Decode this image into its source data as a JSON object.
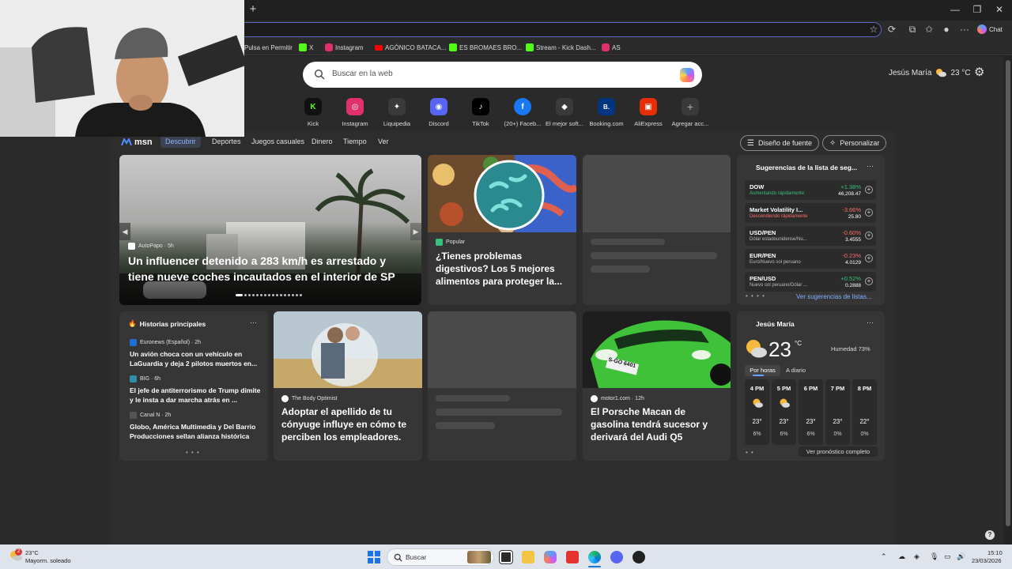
{
  "browser": {
    "new_tab": "+",
    "minimize": "—",
    "maximize": "❐",
    "close": "✕",
    "chat_label": "Chat"
  },
  "favorites": [
    {
      "label": "Pulsa en Permitir",
      "color": ""
    },
    {
      "label": "X",
      "color": "#53fc18"
    },
    {
      "label": "Instagram",
      "color": "#e1306c"
    },
    {
      "label": "AGÓNICO BATACA...",
      "color": "#ff0000"
    },
    {
      "label": "ES BROMAES BRO...",
      "color": "#53fc18"
    },
    {
      "label": "Stream - Kick Dash...",
      "color": "#53fc18"
    },
    {
      "label": "AS",
      "color": "#e1306c"
    }
  ],
  "search": {
    "placeholder": "Buscar en la web"
  },
  "header": {
    "location": "Jesús María",
    "temp": "23 °C"
  },
  "quicklinks": [
    {
      "label": "Kick",
      "glyph": "K",
      "color": "#53fc18"
    },
    {
      "label": "Instagram",
      "glyph": "◎",
      "color": "#e1306c"
    },
    {
      "label": "Liquipedia",
      "glyph": "✦",
      "color": "#3a3a3a"
    },
    {
      "label": "Discord",
      "glyph": "◉",
      "color": "#5865f2"
    },
    {
      "label": "TikTok",
      "glyph": "♪",
      "color": "#000000"
    },
    {
      "label": "(20+) Faceb...",
      "glyph": "f",
      "color": "#1877f2"
    },
    {
      "label": "El mejor soft...",
      "glyph": "◆",
      "color": "#3a3a3a"
    },
    {
      "label": "Booking.com",
      "glyph": "B.",
      "color": "#003580"
    },
    {
      "label": "AliExpress",
      "glyph": "▣",
      "color": "#e62e04"
    },
    {
      "label": "Agregar acc...",
      "glyph": "+",
      "color": "#3a3a3a"
    }
  ],
  "feed_nav": {
    "logo": "msn",
    "items": [
      "Descubrir",
      "Deportes",
      "Juegos casuales",
      "Dinero",
      "Tiempo",
      "Ver"
    ],
    "font_design": "Diseño de fuente",
    "personalize": "Personalizar"
  },
  "hero": {
    "source": "AutoPapo · 5h",
    "headline": "Un influencer detenido a 283 km/h es arrestado y tiene nueve coches incautados en el interior de SP"
  },
  "card_digestive": {
    "source": "Popular",
    "headline": "¿Tienes problemas digestivos? Los 5 mejores alimentos para proteger la..."
  },
  "watchlist": {
    "title": "Sugerencias de la lista de seg...",
    "more": "···",
    "link": "Ver sugerencias de listas...",
    "items": [
      {
        "name": "DOW",
        "sub": "Aumentando rápidamente",
        "pct": "+1.38%",
        "value": "46,208.47",
        "up": true
      },
      {
        "name": "Market Volatility I...",
        "sub": "Descendiendo rápidamente",
        "pct": "-3.66%",
        "value": "25.80",
        "up": false
      },
      {
        "name": "USD/PEN",
        "sub": "Dólar estadounidense/Nu...",
        "pct": "-0.60%",
        "value": "3.4555",
        "up": false
      },
      {
        "name": "EUR/PEN",
        "sub": "Euro/Nuevo sol peruano",
        "pct": "-0.23%",
        "value": "4.0129",
        "up": false
      },
      {
        "name": "PEN/USD",
        "sub": "Nuevo sol peruano/Dólar ...",
        "pct": "+0.52%",
        "value": "0.2888",
        "up": true
      }
    ]
  },
  "top_stories": {
    "title": "Historias principales",
    "more": "···",
    "items": [
      {
        "source": "Euronews (Español) · 2h",
        "headline": "Un avión choca con un vehículo en LaGuardia y deja 2 pilotos muertos en..."
      },
      {
        "source": "BIG · 6h",
        "headline": "El jefe de antiterrorismo de Trump dimite y le insta a dar marcha atrás en ..."
      },
      {
        "source": "Canal N · 2h",
        "headline": "Globo, América Multimedia y Del Barrio Producciones sellan alianza histórica"
      }
    ]
  },
  "card_wedding": {
    "source": "The Body Optimist",
    "headline": "Adoptar el apellido de tu cónyuge influye en cómo te perciben los empleadores."
  },
  "card_porsche": {
    "source": "motor1.com · 12h",
    "headline": "El Porsche Macan de gasolina tendrá sucesor y derivará del Audi Q5",
    "plate": "S-GO 6401"
  },
  "weather": {
    "location": "Jesús María",
    "more": "···",
    "temp": "23",
    "unit": "°C",
    "humidity": "Humedad 73%",
    "tab_hourly": "Por horas",
    "tab_daily": "A diario",
    "link": "Ver pronóstico completo",
    "hours": [
      {
        "h": "4 PM",
        "t": "23°",
        "r": "6%",
        "icon": "partly-sunny"
      },
      {
        "h": "5 PM",
        "t": "23°",
        "r": "6%",
        "icon": "partly-sunny"
      },
      {
        "h": "6 PM",
        "t": "23°",
        "r": "6%",
        "icon": "none"
      },
      {
        "h": "7 PM",
        "t": "23°",
        "r": "0%",
        "icon": "none"
      },
      {
        "h": "8 PM",
        "t": "22°",
        "r": "0%",
        "icon": "none"
      }
    ]
  },
  "taskbar": {
    "weather_temp": "23°C",
    "weather_desc": "Mayorm. soleado",
    "weather_badge": "2",
    "search_label": "Buscar",
    "time": "15:10",
    "date": "23/03/2026"
  },
  "help": "?"
}
